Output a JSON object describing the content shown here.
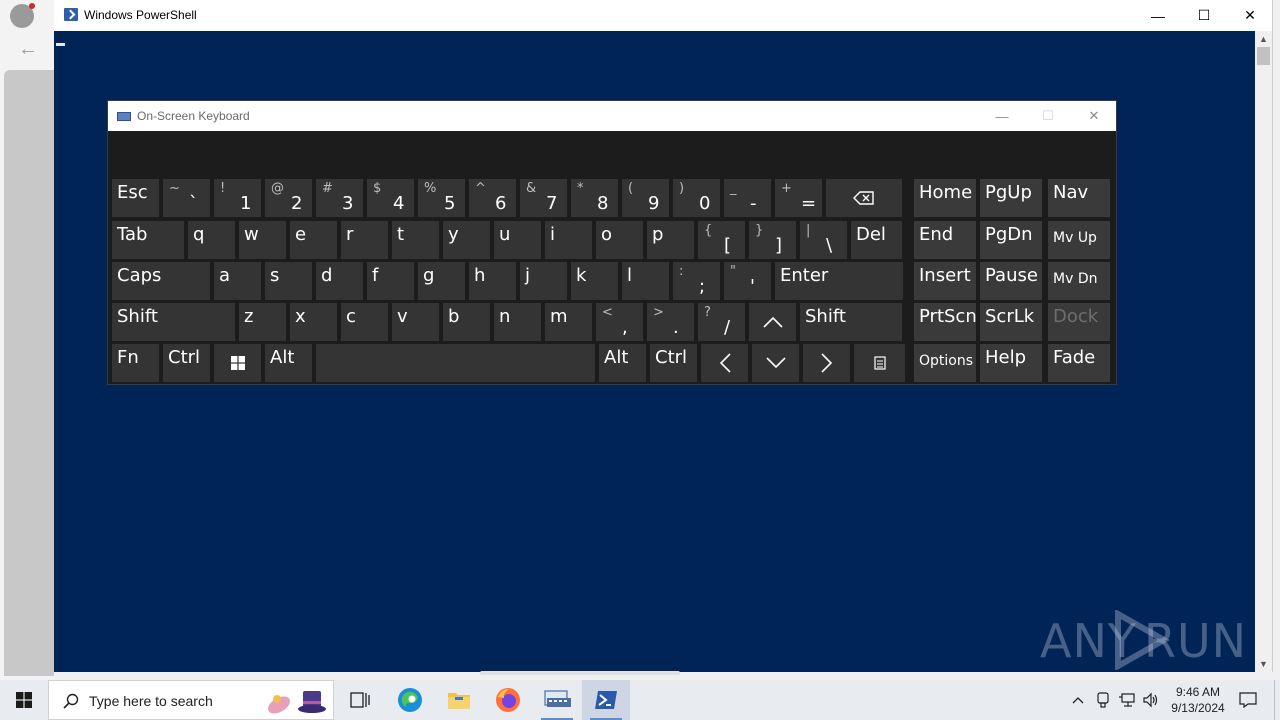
{
  "powershell": {
    "title": "Windows PowerShell",
    "minimize": "—",
    "maximize": "☐",
    "close": "✕"
  },
  "osk": {
    "title": "On-Screen Keyboard",
    "minimize": "—",
    "maximize": "☐",
    "close": "✕",
    "rows": [
      [
        {
          "label": "Esc",
          "w": 47
        },
        {
          "top": "~",
          "bottom": "`",
          "alt": true,
          "w": 47
        },
        {
          "top": "!",
          "bottom": "1",
          "w": 47
        },
        {
          "top": "@",
          "bottom": "2",
          "w": 47
        },
        {
          "top": "#",
          "bottom": "3",
          "w": 47
        },
        {
          "top": "$",
          "bottom": "4",
          "w": 47
        },
        {
          "top": "%",
          "bottom": "5",
          "w": 47
        },
        {
          "top": "^",
          "bottom": "6",
          "w": 47
        },
        {
          "top": "&",
          "bottom": "7",
          "w": 47
        },
        {
          "top": "*",
          "bottom": "8",
          "w": 47
        },
        {
          "top": "(",
          "bottom": "9",
          "w": 47
        },
        {
          "top": ")",
          "bottom": "0",
          "w": 47
        },
        {
          "top": "_",
          "bottom": "-",
          "w": 47
        },
        {
          "top": "+",
          "bottom": "=",
          "w": 47
        },
        {
          "icon": "backspace",
          "w": 76
        }
      ],
      [
        {
          "label": "Tab",
          "w": 72
        },
        {
          "label": "q",
          "w": 47
        },
        {
          "label": "w",
          "w": 47
        },
        {
          "label": "e",
          "w": 47
        },
        {
          "label": "r",
          "w": 47
        },
        {
          "label": "t",
          "w": 47
        },
        {
          "label": "y",
          "w": 47
        },
        {
          "label": "u",
          "w": 47
        },
        {
          "label": "i",
          "w": 47
        },
        {
          "label": "o",
          "w": 47
        },
        {
          "label": "p",
          "w": 47
        },
        {
          "top": "{",
          "bottom": "[",
          "w": 47
        },
        {
          "top": "}",
          "bottom": "]",
          "w": 47
        },
        {
          "top": "|",
          "bottom": "\\",
          "w": 47
        },
        {
          "label": "Del",
          "w": 51
        }
      ],
      [
        {
          "label": "Caps",
          "w": 98
        },
        {
          "label": "a",
          "w": 47
        },
        {
          "label": "s",
          "w": 47
        },
        {
          "label": "d",
          "w": 47
        },
        {
          "label": "f",
          "w": 47
        },
        {
          "label": "g",
          "w": 47
        },
        {
          "label": "h",
          "w": 47
        },
        {
          "label": "j",
          "w": 47
        },
        {
          "label": "k",
          "w": 47
        },
        {
          "label": "l",
          "w": 47
        },
        {
          "top": ":",
          "bottom": ";",
          "w": 47
        },
        {
          "top": "\"",
          "bottom": "'",
          "w": 47
        },
        {
          "label": "Enter",
          "w": 128
        }
      ],
      [
        {
          "label": "Shift",
          "w": 123
        },
        {
          "label": "z",
          "w": 47
        },
        {
          "label": "x",
          "w": 47
        },
        {
          "label": "c",
          "w": 47
        },
        {
          "label": "v",
          "w": 47
        },
        {
          "label": "b",
          "w": 47
        },
        {
          "label": "n",
          "w": 47
        },
        {
          "label": "m",
          "w": 47
        },
        {
          "top": "<",
          "bottom": ",",
          "w": 47
        },
        {
          "top": ">",
          "bottom": ".",
          "w": 47
        },
        {
          "top": "?",
          "bottom": "/",
          "w": 47
        },
        {
          "icon": "up",
          "w": 47
        },
        {
          "label": "Shift",
          "w": 102
        }
      ],
      [
        {
          "label": "Fn",
          "w": 47
        },
        {
          "label": "Ctrl",
          "w": 47
        },
        {
          "icon": "windows",
          "w": 47
        },
        {
          "label": "Alt",
          "w": 47
        },
        {
          "label": "",
          "w": 279
        },
        {
          "label": "Alt",
          "w": 47
        },
        {
          "label": "Ctrl",
          "w": 47
        },
        {
          "icon": "left",
          "w": 47
        },
        {
          "icon": "down",
          "w": 47
        },
        {
          "icon": "right",
          "w": 47
        },
        {
          "icon": "menu",
          "w": 51
        }
      ]
    ],
    "nav": [
      [
        "Home",
        "PgUp",
        "Nav"
      ],
      [
        "End",
        "PgDn",
        "Mv Up"
      ],
      [
        "Insert",
        "Pause",
        "Mv Dn"
      ],
      [
        "PrtScn",
        "ScrLk",
        "Dock"
      ],
      [
        "Options",
        "Help",
        "Fade"
      ]
    ]
  },
  "taskbar": {
    "search_placeholder": "Type here to search",
    "time": "9:46 AM",
    "date": "9/13/2024"
  },
  "watermark": "ANY RUN"
}
